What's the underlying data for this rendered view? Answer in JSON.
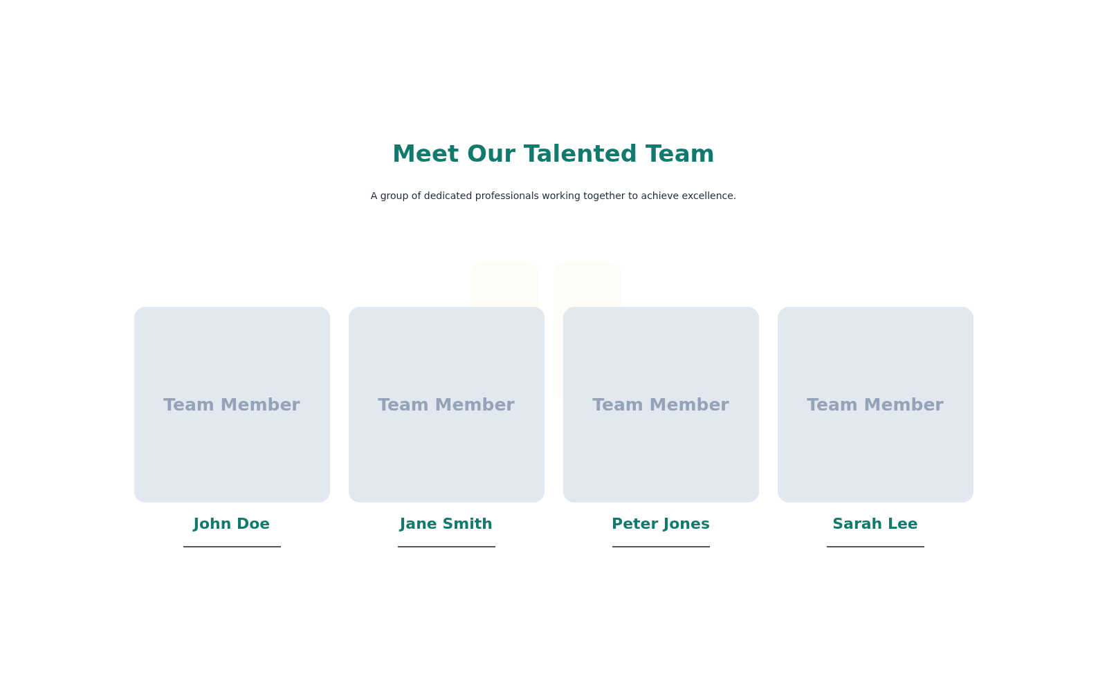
{
  "heading": "Meet Our Talented Team",
  "subtitle": "A group of dedicated professionals working together to achieve excellence.",
  "members": [
    {
      "photo_label": "Team Member",
      "name": "John Doe"
    },
    {
      "photo_label": "Team Member",
      "name": "Jane Smith"
    },
    {
      "photo_label": "Team Member",
      "name": "Peter Jones"
    },
    {
      "photo_label": "Team Member",
      "name": "Sarah Lee"
    }
  ]
}
